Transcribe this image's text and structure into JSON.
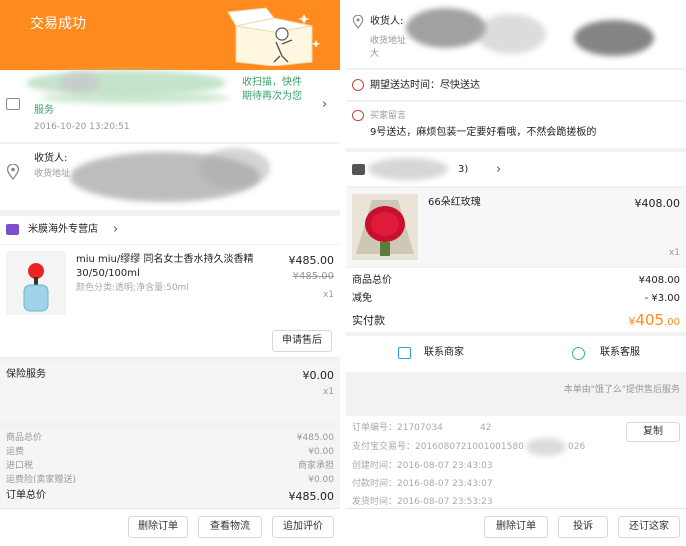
{
  "left": {
    "header": {
      "title": "交易成功",
      "bg_color": "#ff8a1e"
    },
    "logistics": {
      "message": "收扫描，快件",
      "message2": "期待再次为您",
      "message3": "服务",
      "time": "2016-10-20 13:20:51"
    },
    "address": {
      "label": "收货人:",
      "line2": "收货地址"
    },
    "store": {
      "name": "米膜海外专营店"
    },
    "product": {
      "title": "miu miu/缪缪 同名女士香水持久淡香精",
      "title2": "30/50/100ml",
      "spec": "颜色分类:透明;净含量:50ml",
      "price": "¥485.00",
      "orig_price": "¥485.00",
      "qty": "x1",
      "refund_button": "申请售后"
    },
    "insurance": {
      "label": "保险服务",
      "price": "¥0.00",
      "qty": "x1"
    },
    "summary": [
      {
        "label": "商品总价",
        "value": "¥485.00"
      },
      {
        "label": "运费",
        "value": "¥0.00"
      },
      {
        "label": "进口税",
        "value": "商家承担"
      },
      {
        "label": "运费险(卖家赠送)",
        "value": "¥0.00"
      }
    ],
    "order_total": {
      "label": "订单总价",
      "value": "¥485.00"
    },
    "actions": {
      "delete": "删除订单",
      "logistics": "查看物流",
      "review": "追加评价"
    }
  },
  "right": {
    "address": {
      "label": "收货人:",
      "line2": "收货地址",
      "line3": "大"
    },
    "delivery": {
      "text": "期望送达时间：尽快送达"
    },
    "note": {
      "title": "买家留言",
      "text": "9号送达，麻烦包装一定要好看哦，不然会跪搓板的"
    },
    "store": {
      "suffix": "3)"
    },
    "product": {
      "title": "66朵红玫瑰",
      "price": "¥408.00",
      "qty": "x1"
    },
    "summary": [
      {
        "label": "商品总价",
        "value": "¥408.00"
      },
      {
        "label": "减免",
        "value": "- ¥3.00"
      }
    ],
    "paid": {
      "label": "实付款",
      "currency": "¥",
      "amount": "405",
      "decimals": ".00",
      "color": "#ff8a1e"
    },
    "contact": {
      "merchant": "联系商家",
      "service": "联系客服"
    },
    "service_note": "本单由\"饿了么\"提供售后服务",
    "order_info": {
      "order_no": "订单编号：21707034",
      "order_no_tail": "42",
      "copy_button": "复制",
      "alipay_no": "支付宝交易号：2016080721001001580",
      "alipay_tail": "026",
      "created": "创建时间：2016-08-07 23:43:03",
      "paid": "付款时间：2016-08-07 23:43:07",
      "shipped": "发货时间：2016-08-07 23:53:23"
    },
    "actions": {
      "delete": "删除订单",
      "complain": "投诉",
      "again": "还订这家"
    }
  }
}
